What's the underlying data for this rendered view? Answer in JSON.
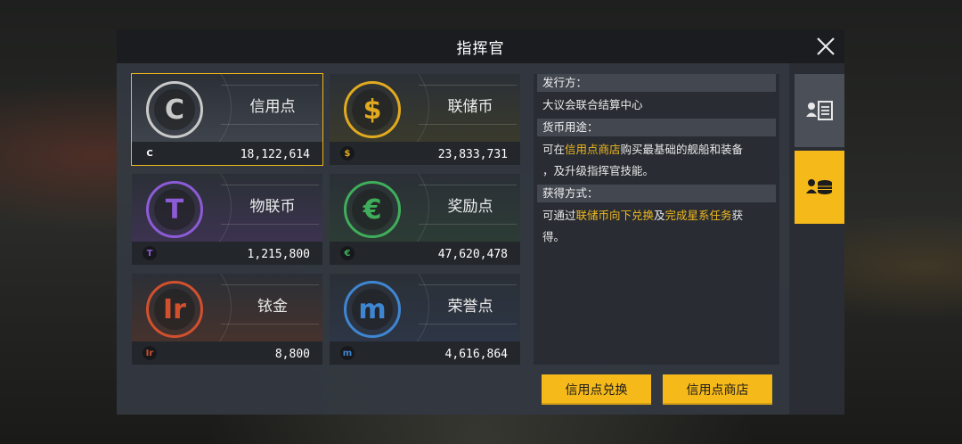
{
  "window": {
    "title": "指挥官"
  },
  "currencies": [
    {
      "name": "信用点",
      "glyph": "C",
      "value": "18,122,614",
      "color": "#c9c9c9",
      "tint": "#3f444c",
      "selected": true
    },
    {
      "name": "联储币",
      "glyph": "$",
      "value": "23,833,731",
      "color": "#e0a91f",
      "tint": "#3a3a2c",
      "selected": false
    },
    {
      "name": "物联币",
      "glyph": "T",
      "value": "1,215,800",
      "color": "#8c5bd6",
      "tint": "#3c3350",
      "selected": false
    },
    {
      "name": "奖励点",
      "glyph": "€",
      "value": "47,620,478",
      "color": "#3fae5a",
      "tint": "#2c3c35",
      "selected": false
    },
    {
      "name": "铱金",
      "glyph": "Ir",
      "value": "8,800",
      "color": "#d2502e",
      "tint": "#46322d",
      "selected": false
    },
    {
      "name": "荣誉点",
      "glyph": "m",
      "value": "4,616,864",
      "color": "#3f86d2",
      "tint": "#2d3646",
      "selected": false
    }
  ],
  "info": {
    "issuer_label": "发行方：",
    "issuer_value": "大议会联合结算中心",
    "usage_label": "货币用途：",
    "usage_pre": "可在",
    "usage_link": "信用点商店",
    "usage_post": "购买最基础的舰船和装备",
    "usage_line2": "，及升级指挥官技能。",
    "obtain_label": "获得方式：",
    "obtain_pre": "可通过",
    "obtain_link1": "联储币向下兑换",
    "obtain_mid": "及",
    "obtain_link2": "完成星系任务",
    "obtain_post": "获",
    "obtain_line2": "得。"
  },
  "buttons": {
    "exchange": "信用点兑换",
    "shop": "信用点商店"
  },
  "side_tabs": [
    {
      "icon": "profile-list-icon",
      "active": false
    },
    {
      "icon": "user-coins-icon",
      "active": true
    }
  ],
  "colors": {
    "accent": "#f6b91a",
    "panel": "#343942"
  }
}
